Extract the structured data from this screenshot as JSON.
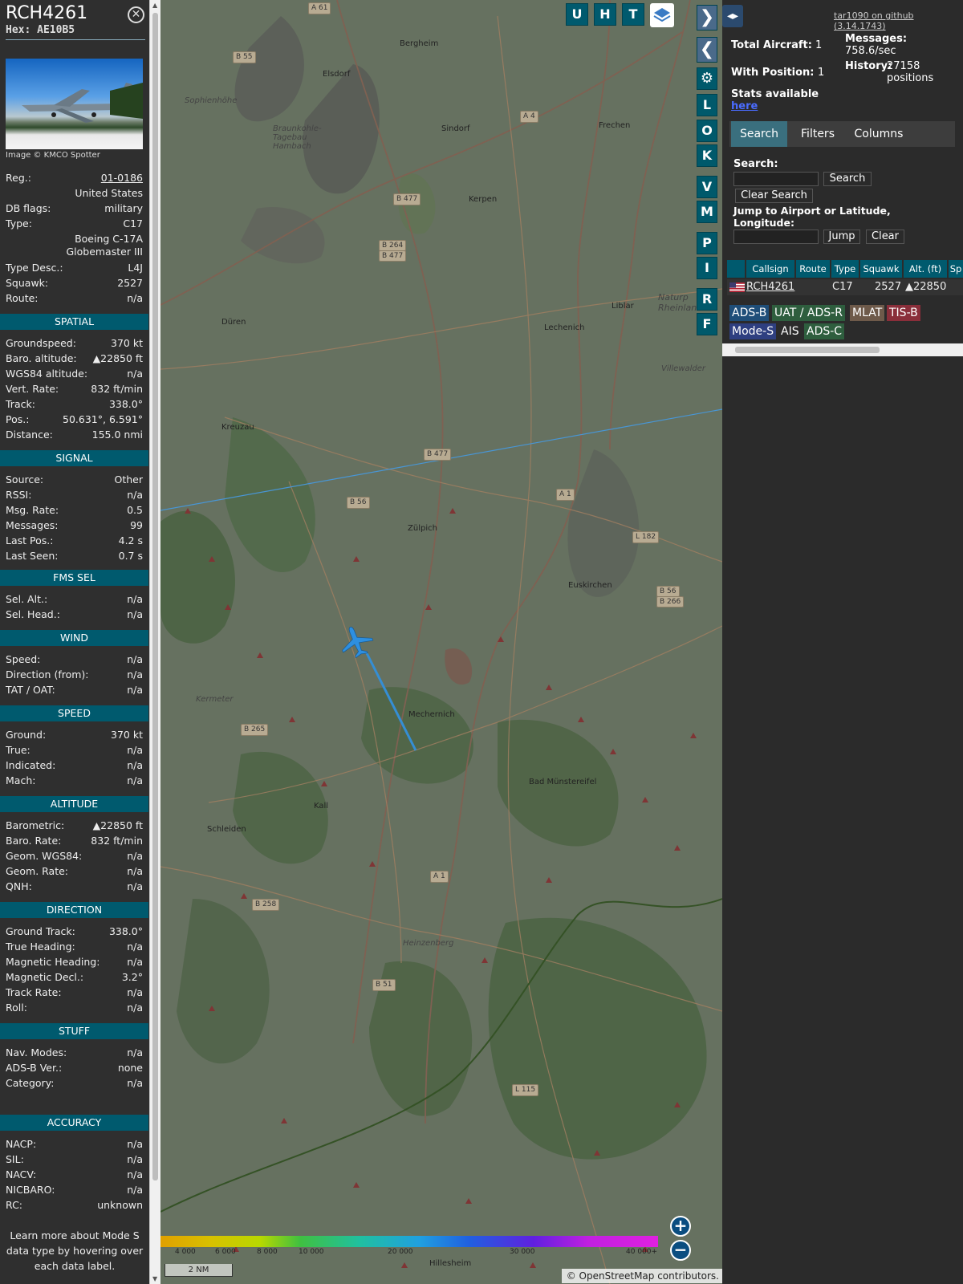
{
  "infoblock": {
    "callsign": "RCH4261",
    "hex_label": "Hex: AE10B5",
    "image_credit": "Image © KMCO Spotter",
    "fields": [
      {
        "label": "Reg.:",
        "value": "01-0186",
        "link": true
      },
      {
        "label": "",
        "value": "United States"
      },
      {
        "label": "DB flags:",
        "value": "military"
      },
      {
        "label": "Type:",
        "value": "C17"
      },
      {
        "label": "",
        "value": "Boeing C-17A"
      },
      {
        "label": "",
        "value": "Globemaster III"
      },
      {
        "label": "Type Desc.:",
        "value": "L4J"
      },
      {
        "label": "Squawk:",
        "value": "2527"
      },
      {
        "label": "Route:",
        "value": "n/a"
      }
    ],
    "sections": [
      {
        "title": "SPATIAL",
        "rows": [
          {
            "label": "Groundspeed:",
            "value": "370 kt"
          },
          {
            "label": "Baro. altitude:",
            "value": "▲22850 ft"
          },
          {
            "label": "WGS84 altitude:",
            "value": "n/a"
          },
          {
            "label": "Vert. Rate:",
            "value": "832 ft/min"
          },
          {
            "label": "Track:",
            "value": "338.0°"
          },
          {
            "label": "Pos.:",
            "value": "50.631°, 6.591°"
          },
          {
            "label": "Distance:",
            "value": "155.0 nmi"
          }
        ]
      },
      {
        "title": "SIGNAL",
        "rows": [
          {
            "label": "Source:",
            "value": "Other"
          },
          {
            "label": "RSSI:",
            "value": "n/a"
          },
          {
            "label": "Msg. Rate:",
            "value": "0.5"
          },
          {
            "label": "Messages:",
            "value": "99"
          },
          {
            "label": "Last Pos.:",
            "value": "4.2 s"
          },
          {
            "label": "Last Seen:",
            "value": "0.7 s"
          }
        ]
      },
      {
        "title": "FMS SEL",
        "rows": [
          {
            "label": "Sel. Alt.:",
            "value": "n/a"
          },
          {
            "label": "Sel. Head.:",
            "value": "n/a"
          }
        ]
      },
      {
        "title": "WIND",
        "rows": [
          {
            "label": "Speed:",
            "value": "n/a"
          },
          {
            "label": "Direction (from):",
            "value": "n/a"
          },
          {
            "label": "TAT / OAT:",
            "value": "n/a"
          }
        ]
      },
      {
        "title": "SPEED",
        "rows": [
          {
            "label": "Ground:",
            "value": "370 kt"
          },
          {
            "label": "True:",
            "value": "n/a"
          },
          {
            "label": "Indicated:",
            "value": "n/a"
          },
          {
            "label": "Mach:",
            "value": "n/a"
          }
        ]
      },
      {
        "title": "ALTITUDE",
        "rows": [
          {
            "label": "Barometric:",
            "value": "▲22850 ft"
          },
          {
            "label": "Baro. Rate:",
            "value": "832 ft/min"
          },
          {
            "label": "Geom. WGS84:",
            "value": "n/a"
          },
          {
            "label": "Geom. Rate:",
            "value": "n/a"
          },
          {
            "label": "QNH:",
            "value": "n/a"
          }
        ]
      },
      {
        "title": "DIRECTION",
        "rows": [
          {
            "label": "Ground Track:",
            "value": "338.0°"
          },
          {
            "label": "True Heading:",
            "value": "n/a"
          },
          {
            "label": "Magnetic Heading:",
            "value": "n/a"
          },
          {
            "label": "Magnetic Decl.:",
            "value": "3.2°"
          },
          {
            "label": "Track Rate:",
            "value": "n/a"
          },
          {
            "label": "Roll:",
            "value": "n/a"
          }
        ]
      },
      {
        "title": "STUFF",
        "rows": [
          {
            "label": "Nav. Modes:",
            "value": "n/a"
          },
          {
            "label": "ADS-B Ver.:",
            "value": "none"
          },
          {
            "label": "Category:",
            "value": "n/a"
          }
        ]
      },
      {
        "title": "ACCURACY",
        "rows": [
          {
            "label": "NACP:",
            "value": "n/a"
          },
          {
            "label": "SIL:",
            "value": "n/a"
          },
          {
            "label": "NACV:",
            "value": "n/a"
          },
          {
            "label": "NICBARO:",
            "value": "n/a"
          },
          {
            "label": "RC:",
            "value": "unknown"
          }
        ]
      }
    ],
    "learn_more": "Learn more about Mode S data type by hovering over each data label."
  },
  "map": {
    "buttons_top": [
      "U",
      "H",
      "T"
    ],
    "buttons_side": [
      "L",
      "O",
      "K",
      "V",
      "M",
      "P",
      "I",
      "R",
      "F"
    ],
    "places": [
      "Bergheim",
      "Elsdorf",
      "Sindorf",
      "Frechen",
      "Kerpen",
      "Düren",
      "Lechenich",
      "Liblar",
      "Kreuzau",
      "Zülpich",
      "Euskirchen",
      "Mechernich",
      "Bad Münstereifel",
      "Kall",
      "Schleiden",
      "Hillesheim",
      "Heinzenberg",
      "Kermeter",
      "Sophienhöhe",
      "Braunkohle-Tagebau Hambach",
      "Villewalder",
      "Naturp Rheinlan"
    ],
    "roads": [
      "A 61",
      "B 55",
      "A 4",
      "B 477",
      "B 264",
      "B 477",
      "B 477",
      "B 56",
      "A 1",
      "L 182",
      "B 56",
      "B 266",
      "B 265",
      "A 1",
      "B 258",
      "B 51",
      "L 115"
    ],
    "altitude_legend": [
      "4 000",
      "6 000",
      "8 000",
      "10 000",
      "20 000",
      "30 000",
      "40 000+"
    ],
    "scale": "2 NM",
    "attribution": "© OpenStreetMap contributors.",
    "zoom_in": "+",
    "zoom_out": "−"
  },
  "right": {
    "github": "tar1090 on github (3.14.1743)",
    "total_label": "Total Aircraft:",
    "total_value": "1",
    "pos_label": "With Position:",
    "pos_value": "1",
    "stats_label": "Stats available",
    "stats_link": "here",
    "messages_label": "Messages:",
    "messages_value": "758.6/sec",
    "history_label": "History:",
    "history_value": "27158 positions",
    "tabs": [
      "Search",
      "Filters",
      "Columns"
    ],
    "search_label": "Search:",
    "search_btn": "Search",
    "clear_search_btn": "Clear Search",
    "jump_label": "Jump to Airport or Latitude, Longitude:",
    "jump_btn": "Jump",
    "clear_btn": "Clear",
    "columns": [
      "Callsign",
      "Route",
      "Type",
      "Squawk",
      "Alt. (ft)",
      "Sp"
    ],
    "row": {
      "callsign": "RCH4261",
      "route": "",
      "type": "C17",
      "squawk": "2527",
      "alt": "▲22850"
    },
    "badges": [
      {
        "label": "ADS-B",
        "color": "#1f4e79"
      },
      {
        "label": "UAT / ADS-R",
        "color": "#2e5e3e"
      },
      {
        "label": "MLAT",
        "color": "#6e5a4a"
      },
      {
        "label": "TIS-B",
        "color": "#8a2e3a"
      },
      {
        "label": "Mode-S",
        "color": "#2e3f80"
      },
      {
        "label": "AIS",
        "color": "#2b2b2b"
      },
      {
        "label": "ADS-C",
        "color": "#2e5e3e"
      }
    ]
  }
}
